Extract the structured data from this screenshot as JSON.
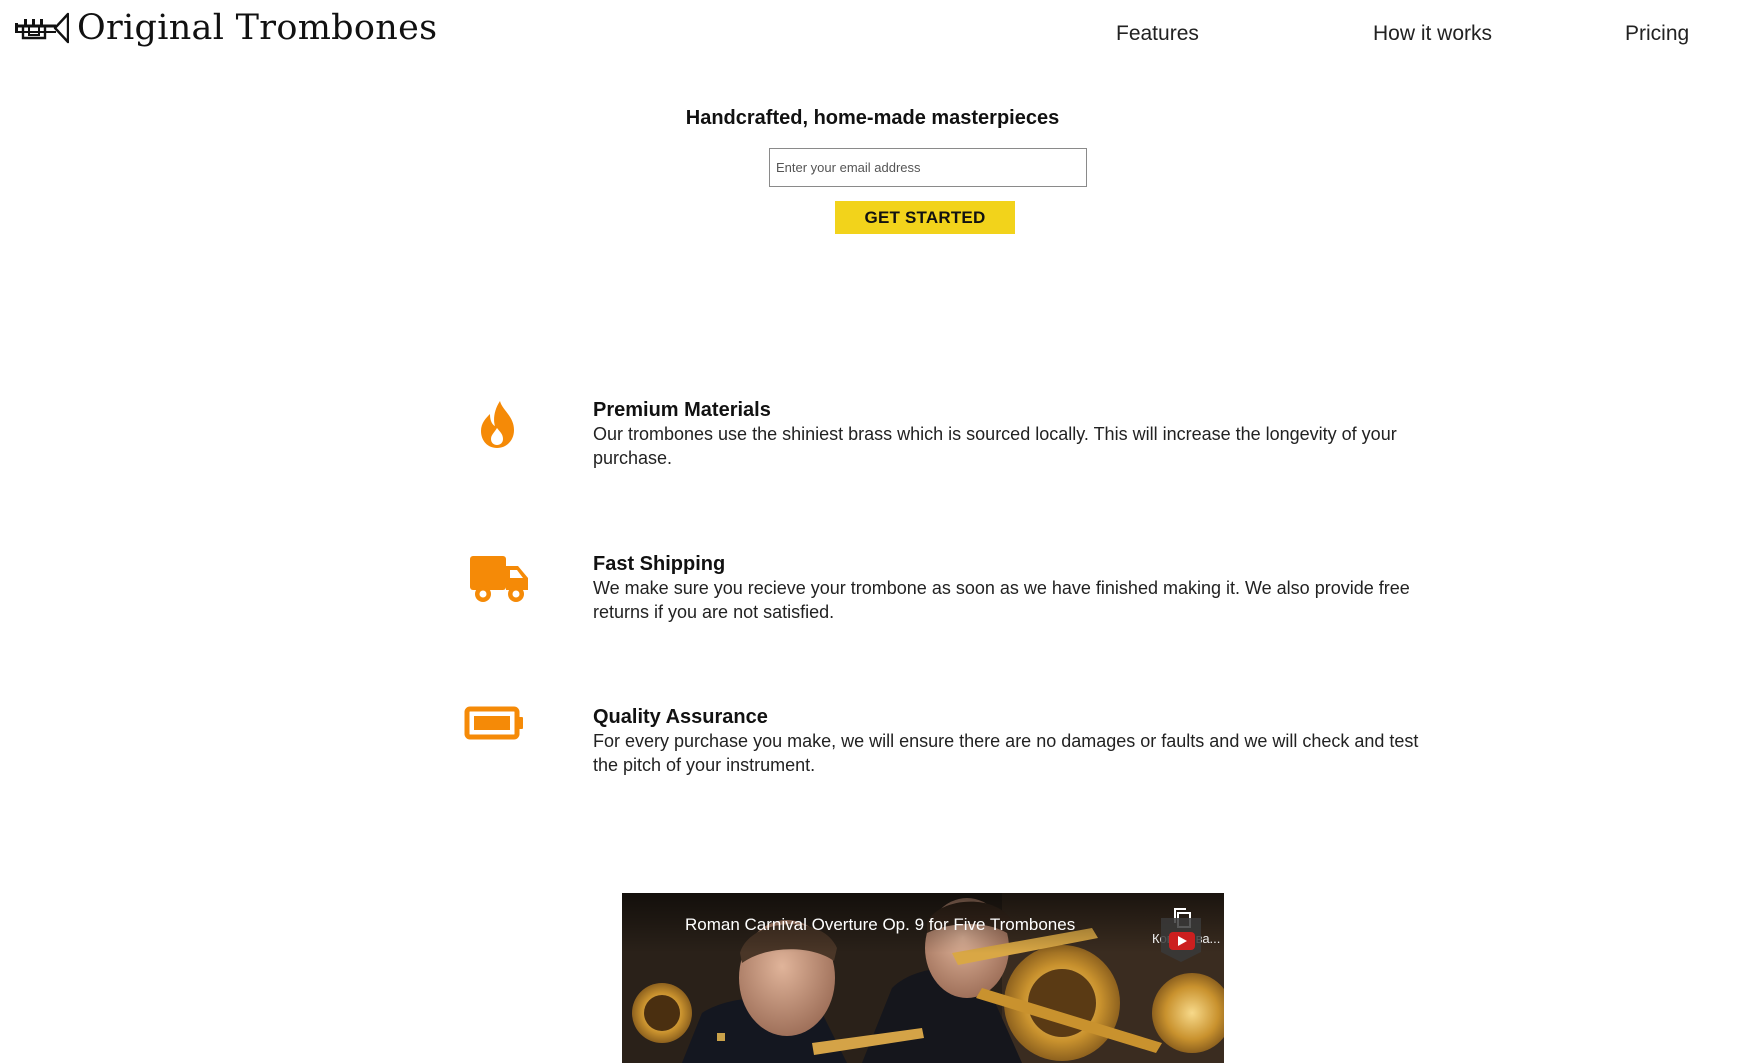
{
  "brand": {
    "name": "Original Trombones",
    "logo_icon": "trombone-icon"
  },
  "nav": {
    "items": [
      {
        "label": "Features"
      },
      {
        "label": "How it works"
      },
      {
        "label": "Pricing"
      }
    ]
  },
  "hero": {
    "title": "Handcrafted, home-made masterpieces",
    "email_placeholder": "Enter your email address",
    "email_value": "",
    "cta_label": "GET STARTED"
  },
  "features": [
    {
      "icon": "flame-icon",
      "title": "Premium Materials",
      "description": "Our trombones use the shiniest brass which is sourced locally. This will increase the longevity of your purchase."
    },
    {
      "icon": "truck-icon",
      "title": "Fast Shipping",
      "description": "We make sure you recieve your trombone as soon as we have finished making it. We also provide free returns if you are not satisfied."
    },
    {
      "icon": "battery-icon",
      "title": "Quality Assurance",
      "description": "For every purchase you make, we will ensure there are no damages or faults and we will check and test the pitch of your instrument."
    }
  ],
  "video": {
    "title": "Roman Carnival Overture Op. 9 for Five Trombones",
    "copy_label": "Копирова...",
    "copy_icon": "copy-icon",
    "play_icon": "youtube-play-icon"
  },
  "colors": {
    "accent_yellow": "#f2d31b",
    "icon_orange": "#f58a07",
    "text": "#111111",
    "background": "#ffffff"
  }
}
